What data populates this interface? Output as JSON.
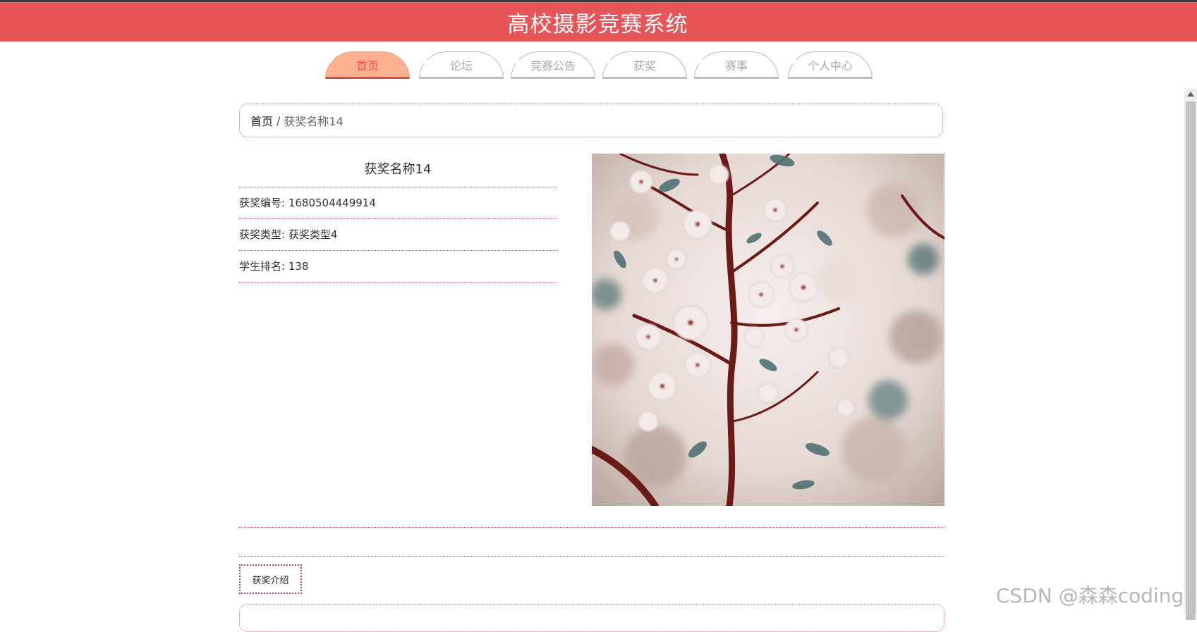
{
  "header": {
    "title": "高校摄影竞赛系统"
  },
  "nav": {
    "tabs": [
      {
        "label": "首页",
        "active": true
      },
      {
        "label": "论坛",
        "active": false
      },
      {
        "label": "竞赛公告",
        "active": false
      },
      {
        "label": "获奖",
        "active": false
      },
      {
        "label": "赛事",
        "active": false
      },
      {
        "label": "个人中心",
        "active": false
      }
    ]
  },
  "breadcrumb": {
    "home": "首页",
    "separator": "/",
    "current": "获奖名称14"
  },
  "detail": {
    "title": "获奖名称14",
    "fields": [
      {
        "label": "获奖编号",
        "value": "1680504449914",
        "text": "获奖编号: 1680504449914"
      },
      {
        "label": "获奖类型",
        "value": "获奖类型4",
        "text": "获奖类型: 获奖类型4"
      },
      {
        "label": "学生排名",
        "value": "138",
        "text": "学生排名: 138"
      }
    ],
    "image": {
      "subject": "cherry-blossom-branch"
    }
  },
  "intro": {
    "tab_label": "获奖介绍"
  },
  "watermark": {
    "text": "CSDN @森森coding"
  },
  "colors": {
    "header_bg": "#e85558",
    "nav_active_bg": "#ffb08e",
    "nav_active_text": "#e8545a",
    "accent_border": "#d46a7a"
  }
}
